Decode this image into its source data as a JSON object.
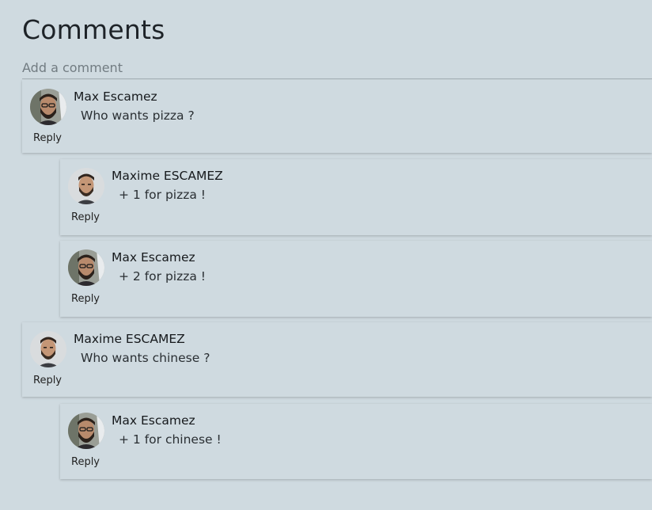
{
  "page": {
    "title": "Comments"
  },
  "add_comment": {
    "placeholder": "Add a comment"
  },
  "comments": [
    {
      "author": "Max Escamez",
      "text": "Who wants pizza ?",
      "reply_label": "Reply",
      "avatar": "avatar-glasses"
    },
    {
      "author": "Maxime ESCAMEZ",
      "text": "+ 1 for pizza !",
      "reply_label": "Reply",
      "avatar": "avatar-portrait"
    },
    {
      "author": "Max Escamez",
      "text": "+ 2 for pizza !",
      "reply_label": "Reply",
      "avatar": "avatar-glasses"
    },
    {
      "author": "Maxime ESCAMEZ",
      "text": "Who wants chinese ?",
      "reply_label": "Reply",
      "avatar": "avatar-portrait"
    },
    {
      "author": "Max Escamez",
      "text": "+ 1 for chinese !",
      "reply_label": "Reply",
      "avatar": "avatar-glasses"
    }
  ]
}
